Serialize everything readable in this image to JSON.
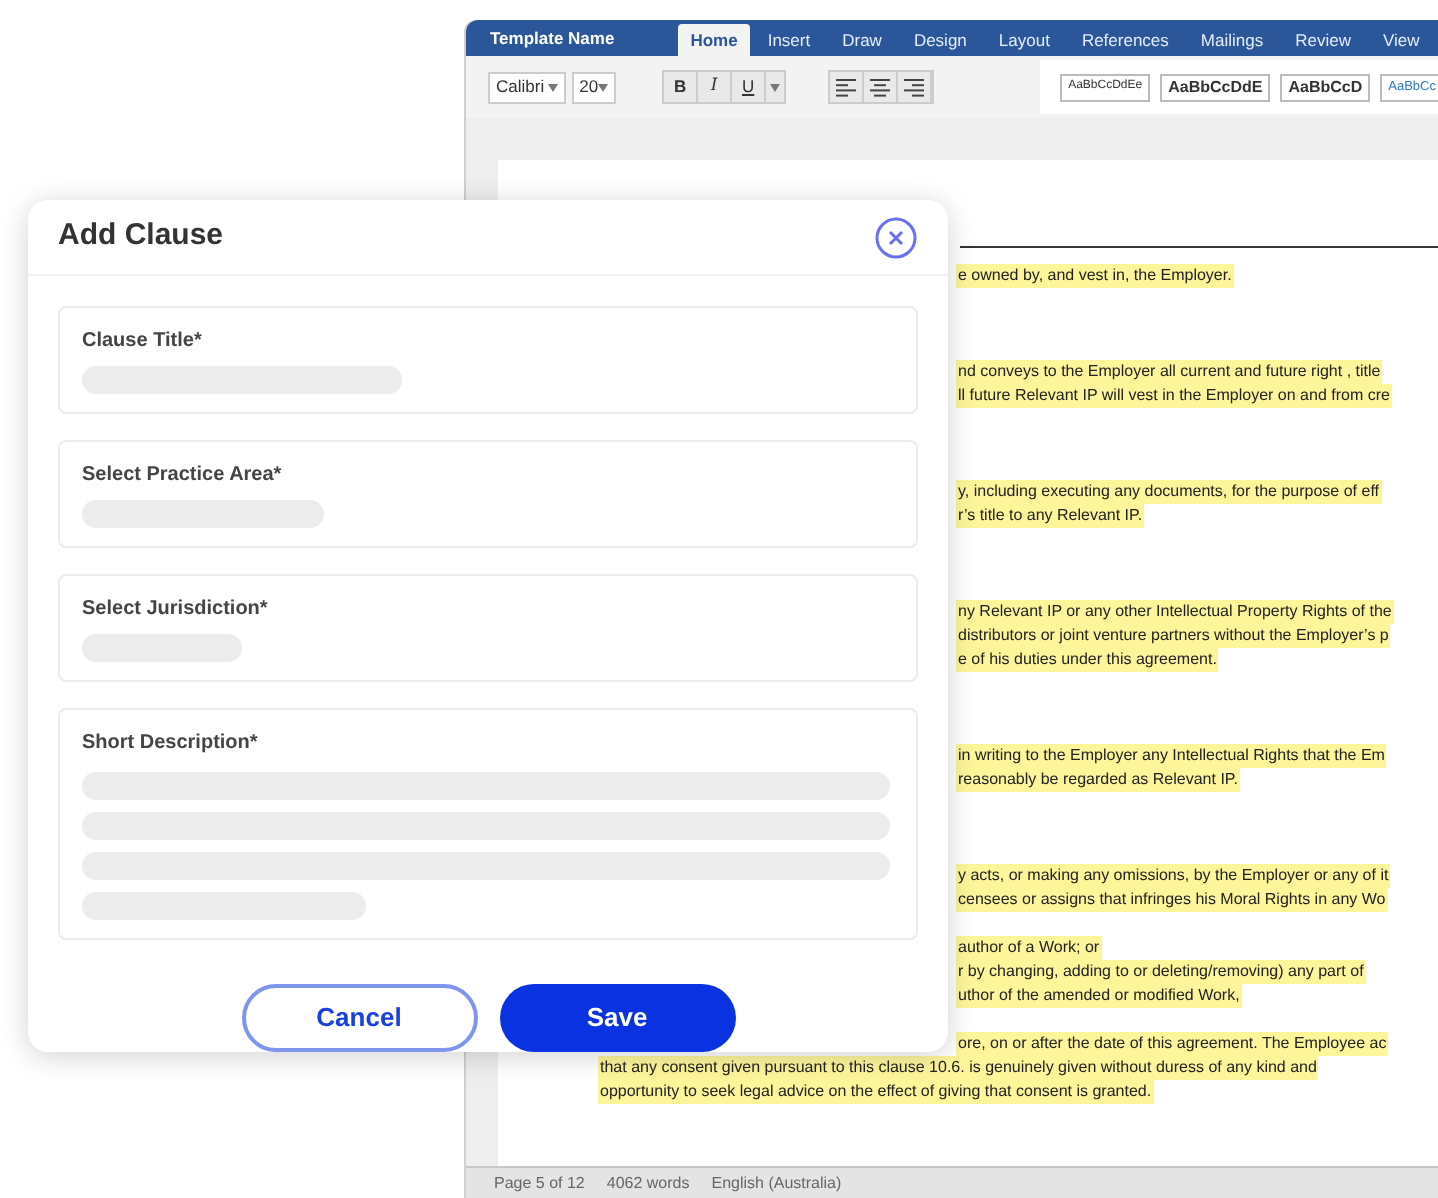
{
  "editor": {
    "title": "Template Name",
    "tabs": [
      {
        "label": "Home",
        "selected": true
      },
      {
        "label": "Insert",
        "selected": false
      },
      {
        "label": "Draw",
        "selected": false
      },
      {
        "label": "Design",
        "selected": false
      },
      {
        "label": "Layout",
        "selected": false
      },
      {
        "label": "References",
        "selected": false
      },
      {
        "label": "Mailings",
        "selected": false
      },
      {
        "label": "Review",
        "selected": false
      },
      {
        "label": "View",
        "selected": false
      }
    ],
    "font": "Calibri",
    "size": "20",
    "format_buttons": [
      "B",
      "I",
      "U"
    ],
    "styles": [
      "AaBbCcDdEe",
      "AaBbCcDdE",
      "AaBbCcD",
      "AaBbCc"
    ],
    "sections": [
      [
        {
          "lines": [
            {
              "text": "e owned by, and vest in, the Employer.",
              "kind": "right"
            }
          ]
        }
      ],
      [
        {
          "lines": [
            {
              "text": "nd conveys to the Employer all current and future right , title",
              "kind": "right"
            },
            {
              "text": "ll future Relevant IP will vest in the Employer on and from cre",
              "kind": "right"
            }
          ]
        }
      ],
      [
        {
          "lines": [
            {
              "text": "y, including executing any documents, for the purpose of eff",
              "kind": "right"
            },
            {
              "text": "r’s title to any Relevant IP.",
              "kind": "right"
            }
          ]
        }
      ],
      [
        {
          "lines": [
            {
              "text": "ny Relevant IP or any other Intellectual Property Rights of the",
              "kind": "right"
            },
            {
              "text": "distributors or joint venture partners without the Employer’s p",
              "kind": "right"
            },
            {
              "text": "e of his duties under this agreement.",
              "kind": "right"
            }
          ]
        }
      ],
      [
        {
          "lines": [
            {
              "text": "in writing to the Employer any Intellectual Rights that the Em",
              "kind": "right"
            },
            {
              "text": "reasonably be regarded as Relevant IP.",
              "kind": "right"
            }
          ]
        }
      ],
      [
        {
          "lines": [
            {
              "text": "y acts, or making any omissions, by the Employer or any of it",
              "kind": "right"
            },
            {
              "text": "censees or assigns that infringes his Moral Rights in any Wo",
              "kind": "right"
            }
          ]
        },
        {
          "lines": [
            {
              "text": "author of a Work; or",
              "kind": "right"
            },
            {
              "text": "r by changing, adding to or deleting/removing) any part of",
              "kind": "right"
            },
            {
              "text": "uthor of the amended or modified Work,",
              "kind": "right"
            }
          ]
        },
        {
          "lines": [
            {
              "text": "ore, on or after the date of this agreement. The Employee ac",
              "kind": "right"
            },
            {
              "text": "that any consent given pursuant to this clause 10.6. is genuinely given without duress of any kind and",
              "kind": "full"
            },
            {
              "text": "opportunity to seek legal advice on the effect of giving that consent is granted.",
              "kind": "full"
            }
          ]
        }
      ]
    ],
    "status_bar": [
      "Page 5 of 12",
      "4062 words",
      "English (Australia)"
    ]
  },
  "dialog": {
    "title": "Add Clause",
    "fields": [
      {
        "label": "Clause Title*",
        "kind": "single"
      },
      {
        "label": "Select Practice Area*",
        "kind": "single"
      },
      {
        "label": "Select Jurisdiction*",
        "kind": "single"
      },
      {
        "label": "Short Description*",
        "kind": "multi"
      }
    ],
    "cancel": "Cancel",
    "save": "Save"
  }
}
